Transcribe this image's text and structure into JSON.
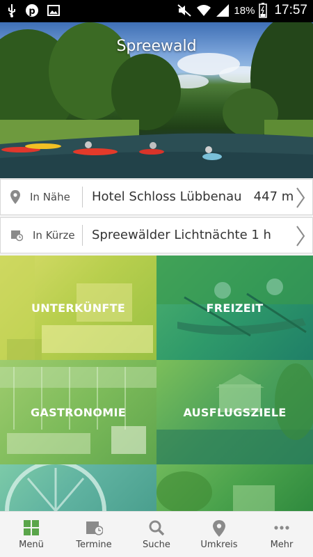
{
  "status_bar": {
    "left_icons": [
      "usb-icon",
      "pinterest-icon",
      "image-icon"
    ],
    "right_icons": [
      "mute-icon",
      "wifi-icon",
      "signal-icon",
      "battery-icon"
    ],
    "battery_percent": "18%",
    "time": "17:57"
  },
  "hero": {
    "title": "Spreewald"
  },
  "nearby": {
    "label": "In Nähe",
    "value": "Hotel Schloss Lübbenau   447 m",
    "icon": "location-pin-icon"
  },
  "soon": {
    "label": "In Kürze",
    "value": "Spreewälder Lichtnächte 1 h",
    "icon": "calendar-clock-icon"
  },
  "tiles": [
    {
      "label": "UNTERKÜNFTE",
      "tint": "#a6c73a"
    },
    {
      "label": "FREIZEIT",
      "tint": "#2f9e6e"
    },
    {
      "label": "GASTRONOMIE",
      "tint": "#7dbb5a"
    },
    {
      "label": "AUSFLUGSZIELE",
      "tint": "#3a9a5e"
    },
    {
      "label": "",
      "tint": "#5fb2a0"
    },
    {
      "label": "",
      "tint": "#4aa24c"
    }
  ],
  "bottom_nav": [
    {
      "label": "Menü",
      "icon": "grid-icon",
      "active": true
    },
    {
      "label": "Termine",
      "icon": "calendar-icon"
    },
    {
      "label": "Suche",
      "icon": "search-icon"
    },
    {
      "label": "Umkreis",
      "icon": "location-pin-icon"
    },
    {
      "label": "Mehr",
      "icon": "more-dots-icon"
    }
  ],
  "colors": {
    "accent_green": "#5aa54a",
    "nav_icon_gray": "#8a8a8a"
  }
}
